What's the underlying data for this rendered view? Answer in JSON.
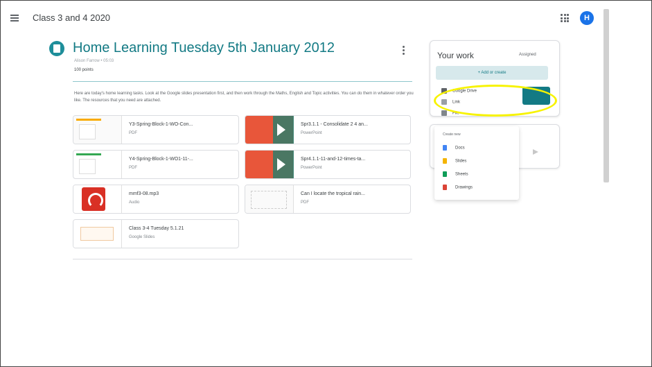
{
  "header": {
    "class_name": "Class 3 and 4 2020",
    "avatar_letter": "H"
  },
  "assignment": {
    "title": "Home Learning Tuesday 5th January 2012",
    "meta": "Alison Farrow • 05:03",
    "points": "100 points",
    "description": "Here are today's home learning tasks. Look at the Google slides presentation first, and then work through the Maths, English and Topic activities. You can do them in whatever order you like. The resources that you need are attached."
  },
  "attachments": [
    {
      "name": "Y3-Spring-Block-1-WO-Con...",
      "kind": "PDF",
      "thumb": "pdf-a"
    },
    {
      "name": "Spr3.1.1 - Consolidate 2 4 an...",
      "kind": "PowerPoint",
      "thumb": "ppt"
    },
    {
      "name": "Y4-Spring-Block-1-WO1-11-...",
      "kind": "PDF",
      "thumb": "pdf-b"
    },
    {
      "name": "Spr4.1.1-11-and-12-times-ta...",
      "kind": "PowerPoint",
      "thumb": "ppt"
    },
    {
      "name": "mmf3-08.mp3",
      "kind": "Audio",
      "thumb": "audio"
    },
    {
      "name": "Can I locate the tropical rain...",
      "kind": "PDF",
      "thumb": "map"
    },
    {
      "name": "Class 3-4 Tuesday 5.1.21",
      "kind": "Google Slides",
      "thumb": "slides"
    }
  ],
  "your_work": {
    "title": "Your work",
    "status": "Assigned",
    "add_label": "+ Add or create",
    "menu": [
      {
        "label": "Google Drive",
        "icon": "drive-icon",
        "color": "#5f6368"
      },
      {
        "label": "Link",
        "icon": "link-icon",
        "color": "#5f6368"
      },
      {
        "label": "File",
        "icon": "file-icon",
        "color": "#5f6368"
      }
    ],
    "create_header": "Create new",
    "create_items": [
      {
        "label": "Docs",
        "icon": "docs-icon",
        "color": "#4285f4"
      },
      {
        "label": "Slides",
        "icon": "slides-icon",
        "color": "#f4b400"
      },
      {
        "label": "Sheets",
        "icon": "sheets-icon",
        "color": "#0f9d58"
      },
      {
        "label": "Drawings",
        "icon": "drawings-icon",
        "color": "#db4437"
      }
    ]
  },
  "colors": {
    "accent": "#137a84",
    "highlight": "#f7f300"
  }
}
